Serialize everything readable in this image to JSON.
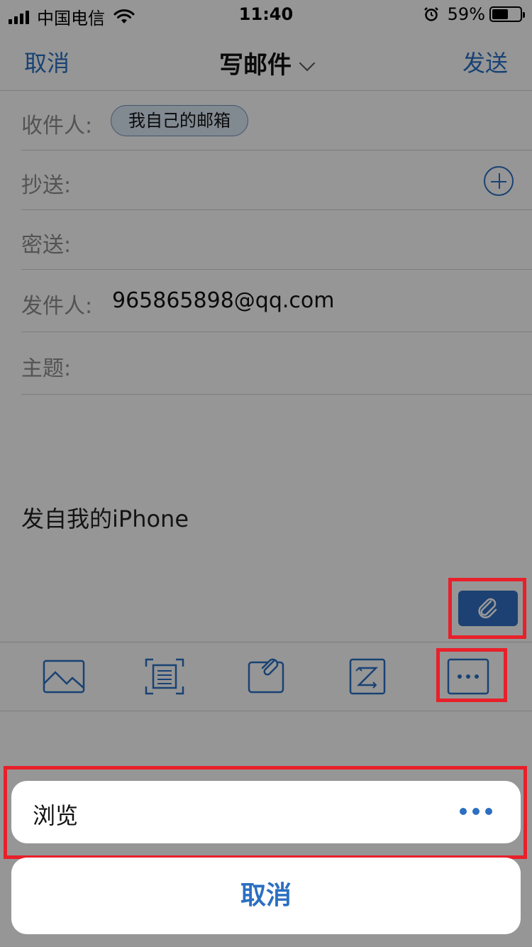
{
  "status_bar": {
    "carrier": "中国电信",
    "time": "11:40",
    "battery": "59%",
    "battery_level": 0.59
  },
  "nav": {
    "cancel": "取消",
    "title": "写邮件",
    "send": "发送"
  },
  "form": {
    "to_label": "收件人:",
    "to_chip": "我自己的邮箱",
    "cc_label": "抄送:",
    "bcc_label": "密送:",
    "from_label": "发件人:",
    "from_value": "965865898@qq.com",
    "subject_label": "主题:"
  },
  "body": {
    "signature": "发自我的iPhone"
  },
  "toolbar": {
    "icons": [
      "image-icon",
      "document-scan-icon",
      "attachment-icon",
      "format-icon",
      "more-icon"
    ]
  },
  "action_sheet": {
    "option_label": "浏览",
    "cancel": "取消"
  },
  "colors": {
    "accent": "#2b6fc1",
    "highlight": "#e8202a",
    "attach_button": "#2f6dbf"
  }
}
